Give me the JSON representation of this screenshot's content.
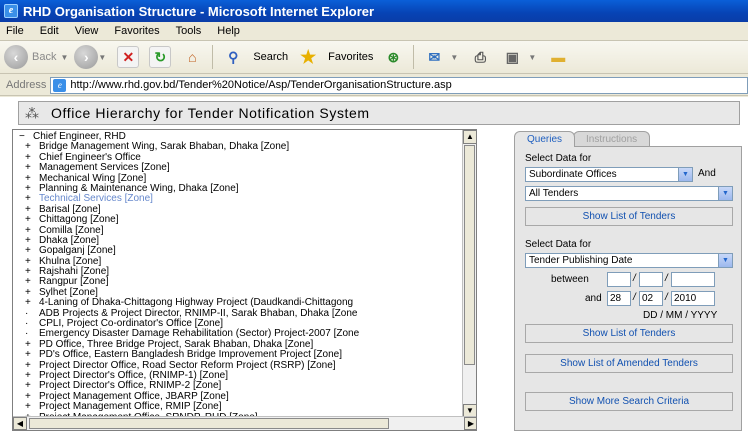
{
  "window": {
    "title": "RHD Organisation Structure - Microsoft Internet Explorer"
  },
  "menu": [
    "File",
    "Edit",
    "View",
    "Favorites",
    "Tools",
    "Help"
  ],
  "toolbar": {
    "back": "Back",
    "search": "Search",
    "favorites": "Favorites"
  },
  "address": {
    "label": "Address",
    "url": "http://www.rhd.gov.bd/Tender%20Notice/Asp/TenderOrganisationStructure.asp"
  },
  "page": {
    "title": "Office Hierarchy for Tender Notification System"
  },
  "tree": {
    "items": [
      {
        "toggle": "−",
        "label": "Chief Engineer, RHD",
        "indent": false,
        "link": false
      },
      {
        "toggle": "+",
        "label": "Bridge Management Wing, Sarak Bhaban, Dhaka [Zone]",
        "indent": true,
        "link": false
      },
      {
        "toggle": "+",
        "label": "Chief Engineer's Office",
        "indent": true,
        "link": false
      },
      {
        "toggle": "+",
        "label": "Management Services [Zone]",
        "indent": true,
        "link": false
      },
      {
        "toggle": "+",
        "label": "Mechanical Wing [Zone]",
        "indent": true,
        "link": false
      },
      {
        "toggle": "+",
        "label": "Planning & Maintenance Wing, Dhaka [Zone]",
        "indent": true,
        "link": false
      },
      {
        "toggle": "+",
        "label": "Technical Services [Zone]",
        "indent": true,
        "link": true
      },
      {
        "toggle": "+",
        "label": "Barisal [Zone]",
        "indent": true,
        "link": false
      },
      {
        "toggle": "+",
        "label": "Chittagong [Zone]",
        "indent": true,
        "link": false
      },
      {
        "toggle": "+",
        "label": "Comilla [Zone]",
        "indent": true,
        "link": false
      },
      {
        "toggle": "+",
        "label": "Dhaka [Zone]",
        "indent": true,
        "link": false
      },
      {
        "toggle": "+",
        "label": "Gopalganj [Zone]",
        "indent": true,
        "link": false
      },
      {
        "toggle": "+",
        "label": "Khulna [Zone]",
        "indent": true,
        "link": false
      },
      {
        "toggle": "+",
        "label": "Rajshahi [Zone]",
        "indent": true,
        "link": false
      },
      {
        "toggle": "+",
        "label": "Rangpur [Zone]",
        "indent": true,
        "link": false
      },
      {
        "toggle": "+",
        "label": "Sylhet [Zone]",
        "indent": true,
        "link": false
      },
      {
        "toggle": "+",
        "label": "4-Laning of Dhaka-Chittagong Highway Project (Daudkandi-Chittagong",
        "indent": true,
        "link": false
      },
      {
        "toggle": "·",
        "label": "ADB Projects & Project Director, RNIMP-II, Sarak Bhaban, Dhaka [Zone",
        "indent": true,
        "link": false
      },
      {
        "toggle": "·",
        "label": "CPLI, Project Co-ordinator's Office [Zone]",
        "indent": true,
        "link": false
      },
      {
        "toggle": "·",
        "label": "Emergency Disaster Damage Rehabilitation (Sector) Project-2007 [Zone",
        "indent": true,
        "link": false
      },
      {
        "toggle": "+",
        "label": "PD Office, Three Bridge Project, Sarak Bhaban, Dhaka [Zone]",
        "indent": true,
        "link": false
      },
      {
        "toggle": "+",
        "label": "PD's Office, Eastern Bangladesh Bridge Improvement Project [Zone]",
        "indent": true,
        "link": false
      },
      {
        "toggle": "+",
        "label": "Project Director Office, Road Sector Reform Project (RSRP) [Zone]",
        "indent": true,
        "link": false
      },
      {
        "toggle": "+",
        "label": "Project Director's Office, (RNIMP-1) [Zone]",
        "indent": true,
        "link": false
      },
      {
        "toggle": "+",
        "label": "Project Director's Office, RNIMP-2 [Zone]",
        "indent": true,
        "link": false
      },
      {
        "toggle": "+",
        "label": "Project Management Office, JBARP [Zone]",
        "indent": true,
        "link": false
      },
      {
        "toggle": "+",
        "label": "Project Management Office, RMIP [Zone]",
        "indent": true,
        "link": false
      },
      {
        "toggle": "+",
        "label": "Project Management Office, SRNDP, RHD [Zone]",
        "indent": true,
        "link": false
      }
    ]
  },
  "panel": {
    "tabs": {
      "queries": "Queries",
      "instructions": "Instructions"
    },
    "select_data_for": "Select Data for",
    "and": "And",
    "select1": "Subordinate Offices",
    "select2": "All Tenders",
    "show_list": "Show List of Tenders",
    "select_data_for_2": "Select Data for",
    "select3": "Tender Publishing Date",
    "between": "between",
    "and_lower": "and",
    "from": {
      "dd": "",
      "mm": "",
      "yyyy": ""
    },
    "to": {
      "dd": "28",
      "mm": "02",
      "yyyy": "2010"
    },
    "slash": "/",
    "date_format": "DD / MM / YYYY",
    "show_list_2": "Show List of Tenders",
    "show_amended": "Show  List of Amended Tenders",
    "show_more": "Show More Search Criteria"
  }
}
